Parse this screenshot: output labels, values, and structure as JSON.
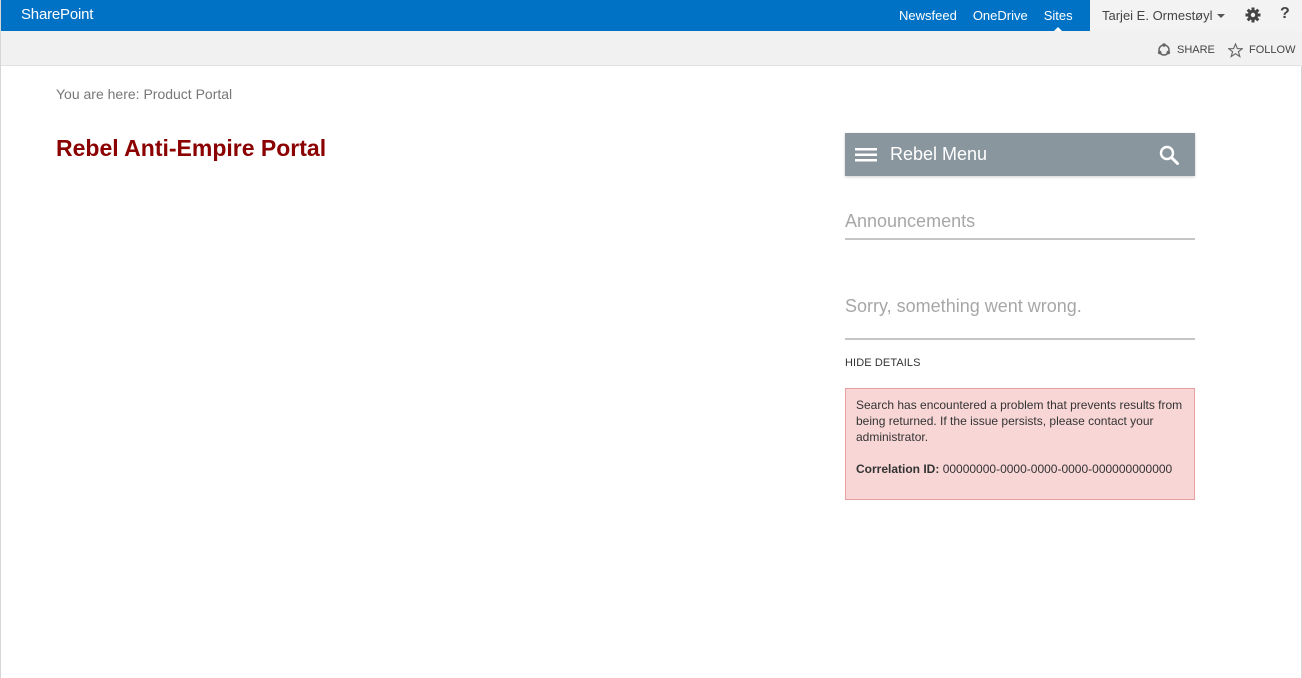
{
  "suitebar": {
    "brand": "SharePoint",
    "nav": [
      {
        "label": "Newsfeed",
        "active": false
      },
      {
        "label": "OneDrive",
        "active": false
      },
      {
        "label": "Sites",
        "active": true
      }
    ],
    "user": "Tarjei E. Ormestøyl",
    "icons": {
      "settings": "gear-icon",
      "help": "help-icon"
    },
    "help_glyph": "?"
  },
  "ribbon": {
    "share_label": "SHARE",
    "follow_label": "FOLLOW"
  },
  "breadcrumb": {
    "prefix": "You are here: ",
    "link": "Product Portal"
  },
  "page": {
    "title": "Rebel Anti-Empire Portal"
  },
  "menu": {
    "title": "Rebel Menu"
  },
  "announcements": {
    "title": "Announcements",
    "error_title": "Sorry, something went wrong.",
    "hide_details": "HIDE DETAILS",
    "error_message": "Search has encountered a problem that prevents results from being returned. If the issue persists, please contact your administrator.",
    "correlation_label": "Correlation ID:",
    "correlation_id": "00000000-0000-0000-0000-000000000000"
  },
  "colors": {
    "suitebar": "#0072c6",
    "title": "#8b0000",
    "menubar": "#8a969e",
    "error_bg": "#f8d6d6",
    "error_border": "#e8a0a0"
  }
}
